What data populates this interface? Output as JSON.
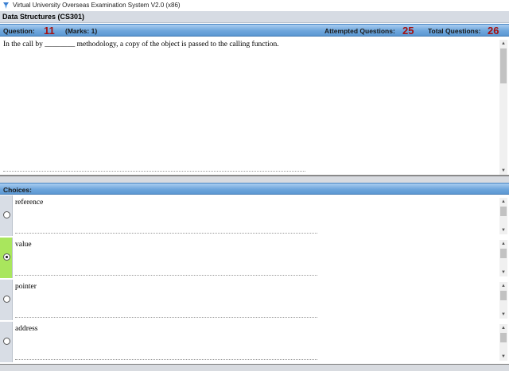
{
  "window": {
    "title": "Virtual University Overseas Examination System  V2.0 (x86)"
  },
  "subject": {
    "title": "Data Structures  (CS301)"
  },
  "question_bar": {
    "question_label": "Question:",
    "question_number": "11",
    "marks_label": "(Marks: 1)",
    "attempted_label": "Attempted Questions:",
    "attempted_value": "25",
    "total_label": "Total Questions:",
    "total_value": "26"
  },
  "question": {
    "text": "In the call by ________ methodology, a copy of the object is passed to the calling function."
  },
  "choices_header": {
    "label": "Choices:"
  },
  "choices": [
    {
      "label": "reference",
      "selected": false
    },
    {
      "label": "value",
      "selected": true
    },
    {
      "label": "pointer",
      "selected": false
    },
    {
      "label": "address",
      "selected": false
    }
  ],
  "colors": {
    "header_blue": "#6ea6dc",
    "number_red": "#a41010",
    "selected_green": "#a9e65d"
  }
}
